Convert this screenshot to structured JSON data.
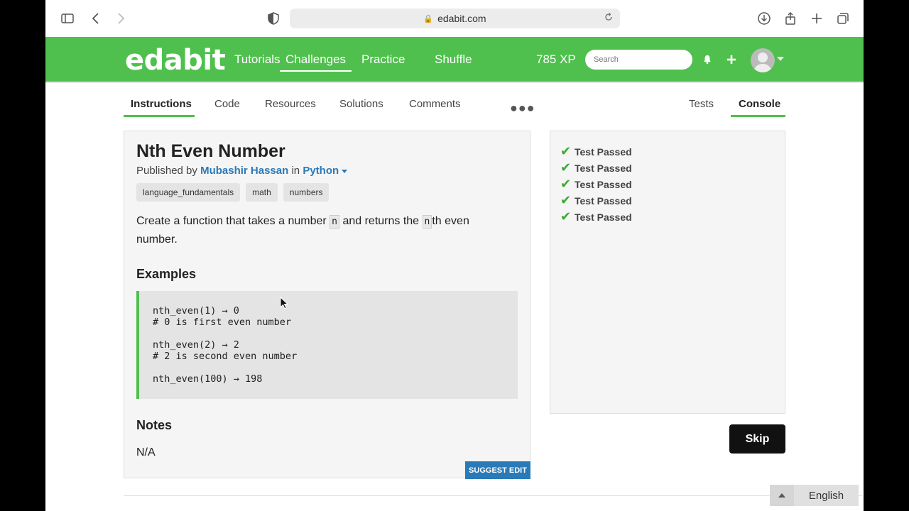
{
  "browser": {
    "url": "edabit.com"
  },
  "header": {
    "logo": "edabit",
    "nav": [
      "Tutorials",
      "Challenges",
      "Practice",
      "Shuffle"
    ],
    "active_nav": "Challenges",
    "xp": "785 XP",
    "search_placeholder": "Search",
    "accent_color": "#4fc04d"
  },
  "tabs": {
    "left": [
      "Instructions",
      "Code",
      "Resources",
      "Solutions",
      "Comments"
    ],
    "right": [
      "Tests",
      "Console"
    ],
    "active_left": "Instructions",
    "active_right": "Console"
  },
  "challenge": {
    "title": "Nth Even Number",
    "published_by_prefix": "Published by",
    "author": "Mubashir Hassan",
    "in_word": "in",
    "language": "Python",
    "tags": [
      "language_fundamentals",
      "math",
      "numbers"
    ],
    "desc_part1": "Create a function that takes a number",
    "desc_code1": "n",
    "desc_part2": "and returns the",
    "desc_code2": "n",
    "desc_part3": "th even number.",
    "examples_heading": "Examples",
    "examples_code": "nth_even(1) → 0\n# 0 is first even number\n\nnth_even(2) → 2\n# 2 is second even number\n\nnth_even(100) → 198",
    "notes_heading": "Notes",
    "notes_text": "N/A",
    "suggest_edit": "SUGGEST EDIT"
  },
  "console": {
    "results": [
      "Test Passed",
      "Test Passed",
      "Test Passed",
      "Test Passed",
      "Test Passed"
    ]
  },
  "actions": {
    "skip": "Skip"
  },
  "footer": {
    "language": "English"
  }
}
